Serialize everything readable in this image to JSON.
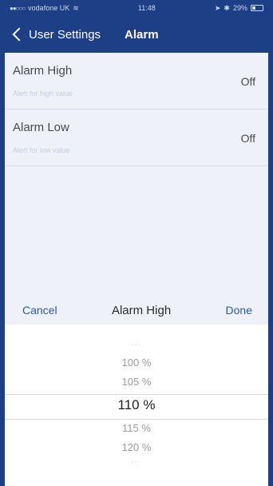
{
  "status": {
    "carrier": "vodafone UK",
    "time": "11:48",
    "battery": "29%"
  },
  "nav": {
    "back_label": "User Settings",
    "title": "Alarm"
  },
  "settings": [
    {
      "title": "Alarm High",
      "subtitle": "Alert for high value",
      "value": "Off"
    },
    {
      "title": "Alarm Low",
      "subtitle": "Alert for low value",
      "value": "Off"
    }
  ],
  "toolbar": {
    "cancel_label": "Cancel",
    "title": "Alarm High",
    "done_label": "Done"
  },
  "picker": {
    "options": [
      "100 %",
      "105 %",
      "110 %",
      "115 %",
      "120 %"
    ],
    "selected": "110 %"
  },
  "colors": {
    "brand": "#1d3f86",
    "accent": "#2c5aa7",
    "background": "#eef1f8"
  }
}
